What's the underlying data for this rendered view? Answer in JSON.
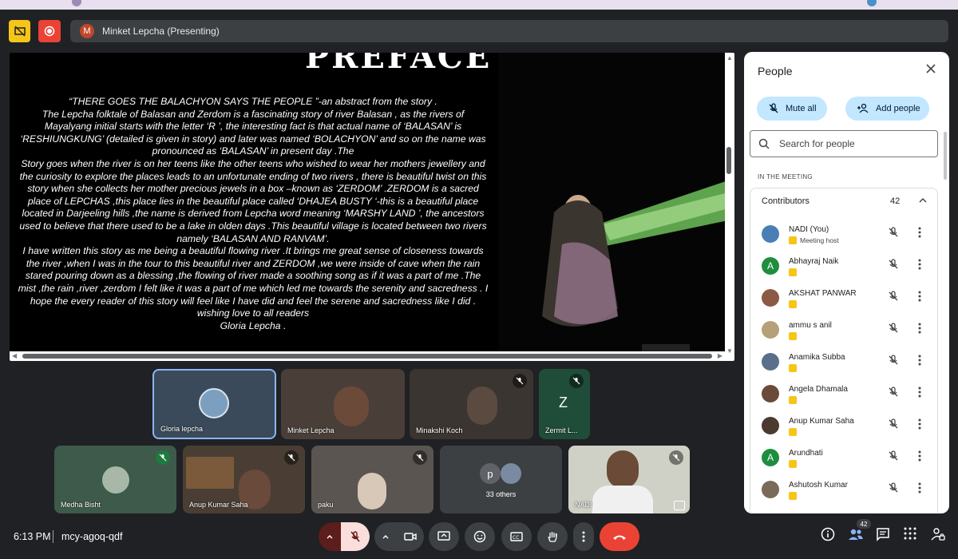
{
  "presenting_bar": {
    "avatar_letter": "M",
    "label": "Minket Lepcha (Presenting)"
  },
  "presentation": {
    "title": "PREFACE",
    "paragraphs": [
      "“THERE GOES THE BALACHYON SAYS THE PEOPLE ”-an abstract from the story .",
      "The  Lepcha folktale of Balasan and Zerdom is a fascinating story of  river Balasan , as the rivers of Mayalyang initial starts with the letter ‘R ’, the interesting  fact is that actual name of ‘BALASAN’ is ‘RESHIUNGKUNG’ (detailed is given in story) and later was named ‘BOLACHYON’  and so on the name was pronounced as ‘BALASAN’ in present day .The",
      "Story goes when the river is on her teens like the other teens who wished to wear her mothers jewellery and the curiosity to explore the places leads to an unfortunate ending of two rivers , there is beautiful twist on this story when she collects her mother precious jewels in a box –known as ‘ZERDOM’ .ZERDOM is a sacred place of LEPCHAS ,this place lies in the beautiful place called ‘DHAJEA BUSTY ‘-this is a beautiful place located in Darjeeling hills ,the name is derived from Lepcha word meaning ‘MARSHY LAND ’, the ancestors used to believe that there used to be a lake in olden days .This beautiful village is located between two rivers namely ‘BALASAN AND RANVAM’.",
      "I have written this story as me being a beautiful flowing river .It brings me great sense of closeness towards the river ,when I was in the tour to this beautiful river and ZERDOM ,we were inside of cave when the rain stared pouring down as a blessing ,the flowing of river made a soothing song as if it was a part of me .The mist ,the rain ,river ,zerdom I felt like it was a part of me which led me towards the serenity and sacredness . I hope the every reader of this story will feel like I have did and feel the serene and sacredness like I did .",
      "wishing love to all readers",
      "Gloria Lepcha ."
    ]
  },
  "tiles": [
    {
      "name": "Gloria lepcha"
    },
    {
      "name": "Minket Lepcha"
    },
    {
      "name": "Minakshi Koch"
    },
    {
      "name": "Zermit L...",
      "letter": "Z"
    },
    {
      "name": "Medha Bisht"
    },
    {
      "name": "Anup Kumar Saha"
    },
    {
      "name": "paku"
    },
    {
      "name": "33 others",
      "letter": "p"
    },
    {
      "name": "NADI"
    }
  ],
  "people_panel": {
    "title": "People",
    "mute_all": "Mute all",
    "add_people": "Add people",
    "search_placeholder": "Search for people",
    "section_label": "IN THE MEETING",
    "group_label": "Contributors",
    "group_count": "42",
    "people": [
      {
        "name": "NADI (You)",
        "role": "Meeting host",
        "avatar": "",
        "color": "#4a7fb5"
      },
      {
        "name": "Abhayraj Naik",
        "avatar": "A",
        "color": "#1e8e3e"
      },
      {
        "name": "AKSHAT PANWAR",
        "avatar": "",
        "color": "#8a5a44"
      },
      {
        "name": "ammu s anil",
        "avatar": "",
        "color": "#b5a07a"
      },
      {
        "name": "Anamika Subba",
        "avatar": "",
        "color": "#5b6f8a"
      },
      {
        "name": "Angela Dhamala",
        "avatar": "",
        "color": "#6b4a3a"
      },
      {
        "name": "Anup Kumar Saha",
        "avatar": "",
        "color": "#4a3a30"
      },
      {
        "name": "Arundhati",
        "avatar": "A",
        "color": "#1e8e3e"
      },
      {
        "name": "Ashutosh Kumar",
        "avatar": "",
        "color": "#7a6a5a"
      }
    ]
  },
  "bottom_bar": {
    "time": "6:13 PM",
    "meeting_code": "mcy-agoq-qdf",
    "people_badge": "42"
  }
}
